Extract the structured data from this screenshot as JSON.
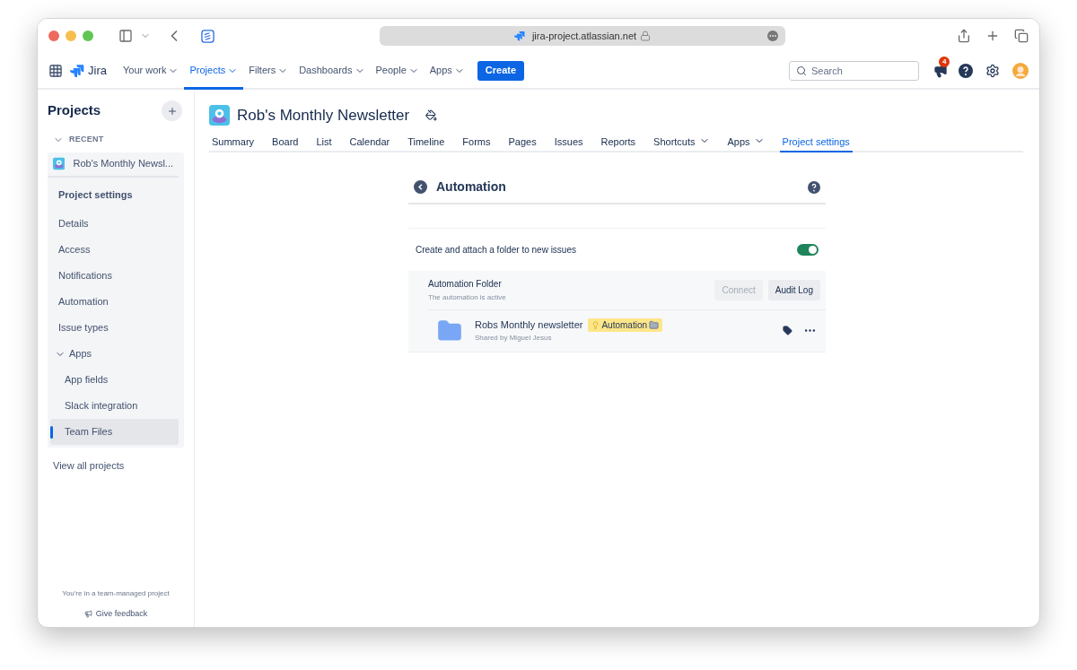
{
  "browser": {
    "url": "jira-project.atlassian.net"
  },
  "topnav": {
    "product": "Jira",
    "items": [
      {
        "label": "Your work",
        "selected": false
      },
      {
        "label": "Projects",
        "selected": true
      },
      {
        "label": "Filters",
        "selected": false
      },
      {
        "label": "Dashboards",
        "selected": false
      },
      {
        "label": "People",
        "selected": false
      },
      {
        "label": "Apps",
        "selected": false
      }
    ],
    "create": "Create",
    "search_placeholder": "Search",
    "notification_count": "4"
  },
  "sidebar": {
    "title": "Projects",
    "recent_label": "RECENT",
    "project_name": "Rob's Monthly Newsl...",
    "section_title": "Project settings",
    "items": [
      {
        "label": "Details",
        "selected": false
      },
      {
        "label": "Access",
        "selected": false
      },
      {
        "label": "Notifications",
        "selected": false
      },
      {
        "label": "Automation",
        "selected": false
      },
      {
        "label": "Issue types",
        "selected": false
      },
      {
        "label": "Apps",
        "selected": false,
        "expanded": true,
        "children": [
          {
            "label": "App fields",
            "selected": false
          },
          {
            "label": "Slack integration",
            "selected": false
          },
          {
            "label": "Team Files",
            "selected": true
          }
        ]
      }
    ],
    "view_all": "View all projects",
    "footer_note": "You're in a team-managed project",
    "feedback": "Give feedback"
  },
  "project": {
    "name": "Rob's Monthly Newsletter",
    "tabs": [
      {
        "label": "Summary",
        "selected": false,
        "dropdown": false
      },
      {
        "label": "Board",
        "selected": false,
        "dropdown": false
      },
      {
        "label": "List",
        "selected": false,
        "dropdown": false
      },
      {
        "label": "Calendar",
        "selected": false,
        "dropdown": false
      },
      {
        "label": "Timeline",
        "selected": false,
        "dropdown": false
      },
      {
        "label": "Forms",
        "selected": false,
        "dropdown": false
      },
      {
        "label": "Pages",
        "selected": false,
        "dropdown": false
      },
      {
        "label": "Issues",
        "selected": false,
        "dropdown": false
      },
      {
        "label": "Reports",
        "selected": false,
        "dropdown": false
      },
      {
        "label": "Shortcuts",
        "selected": false,
        "dropdown": true
      },
      {
        "label": "Apps",
        "selected": false,
        "dropdown": true
      },
      {
        "label": "Project settings",
        "selected": true,
        "dropdown": false
      }
    ]
  },
  "automation": {
    "title": "Automation",
    "toggle": {
      "label": "Create and attach a folder to new issues",
      "on": true
    },
    "folder": {
      "title": "Automation Folder",
      "subtitle": "The automation is active",
      "buttons": [
        {
          "label": "Connect",
          "disabled": true
        },
        {
          "label": "Audit Log",
          "disabled": false
        }
      ]
    },
    "file": {
      "name": "Robs Monthly newsletter",
      "tag": "Automation",
      "shared_by": "Shared by Miguel Jesus"
    }
  }
}
